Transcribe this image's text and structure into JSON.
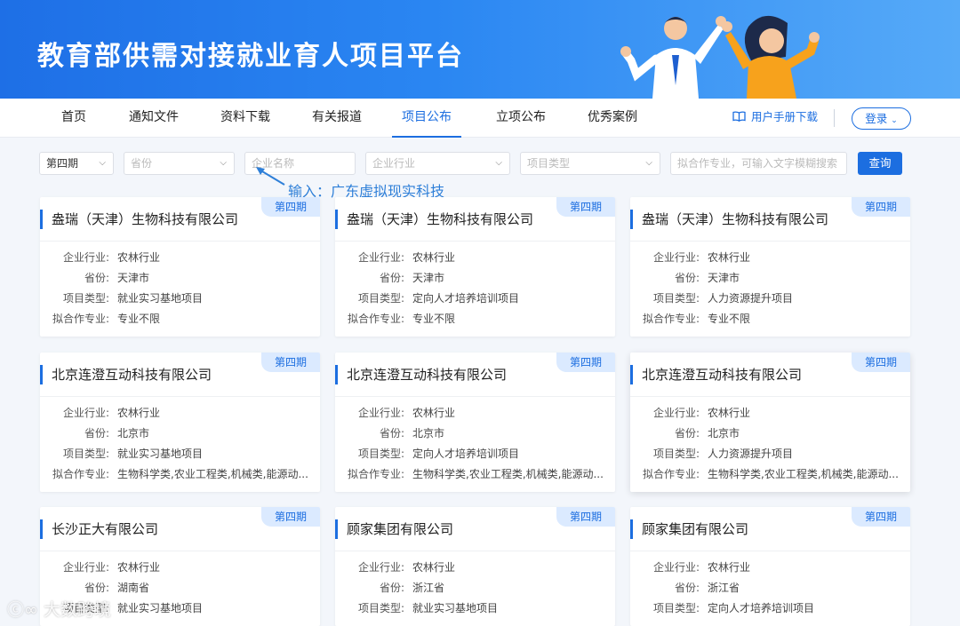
{
  "banner": {
    "title": "教育部供需对接就业育人项目平台"
  },
  "nav": {
    "items": [
      "首页",
      "通知文件",
      "资料下载",
      "有关报道",
      "项目公布",
      "立项公布",
      "优秀案例"
    ],
    "active_index": 4,
    "manual_label": "用户手册下载",
    "login_label": "登录"
  },
  "filters": {
    "period": "第四期",
    "province_placeholder": "省份",
    "company_placeholder": "企业名称",
    "industry_placeholder": "企业行业",
    "type_placeholder": "项目类型",
    "major_placeholder": "拟合作专业，可输入文字模糊搜索",
    "query_label": "查询"
  },
  "annotation": "输入：广东虚拟现实科技",
  "labels": {
    "industry": "企业行业:",
    "province": "省份:",
    "type": "项目类型:",
    "major": "拟合作专业:"
  },
  "cards": [
    {
      "name": "盎瑞（天津）生物科技有限公司",
      "badge": "第四期",
      "industry": "农林行业",
      "province": "天津市",
      "type": "就业实习基地项目",
      "major": "专业不限"
    },
    {
      "name": "盎瑞（天津）生物科技有限公司",
      "badge": "第四期",
      "industry": "农林行业",
      "province": "天津市",
      "type": "定向人才培养培训项目",
      "major": "专业不限"
    },
    {
      "name": "盎瑞（天津）生物科技有限公司",
      "badge": "第四期",
      "industry": "农林行业",
      "province": "天津市",
      "type": "人力资源提升项目",
      "major": "专业不限"
    },
    {
      "name": "北京连澄互动科技有限公司",
      "badge": "第四期",
      "industry": "农林行业",
      "province": "北京市",
      "type": "就业实习基地项目",
      "major": "生物科学类,农业工程类,机械类,能源动..."
    },
    {
      "name": "北京连澄互动科技有限公司",
      "badge": "第四期",
      "industry": "农林行业",
      "province": "北京市",
      "type": "定向人才培养培训项目",
      "major": "生物科学类,农业工程类,机械类,能源动..."
    },
    {
      "name": "北京连澄互动科技有限公司",
      "badge": "第四期",
      "industry": "农林行业",
      "province": "北京市",
      "type": "人力资源提升项目",
      "major": "生物科学类,农业工程类,机械类,能源动..."
    },
    {
      "name": "长沙正大有限公司",
      "badge": "第四期",
      "industry": "农林行业",
      "province": "湖南省",
      "type": "就业实习基地项目",
      "major": ""
    },
    {
      "name": "顾家集团有限公司",
      "badge": "第四期",
      "industry": "农林行业",
      "province": "浙江省",
      "type": "就业实习基地项目",
      "major": ""
    },
    {
      "name": "顾家集团有限公司",
      "badge": "第四期",
      "industry": "农林行业",
      "province": "浙江省",
      "type": "定向人才培养培训项目",
      "major": ""
    }
  ],
  "watermark": "大数跨境",
  "colors": {
    "accent": "#1c6ee0",
    "badge_bg": "#dbeaff",
    "banner": "#2a86f2"
  }
}
